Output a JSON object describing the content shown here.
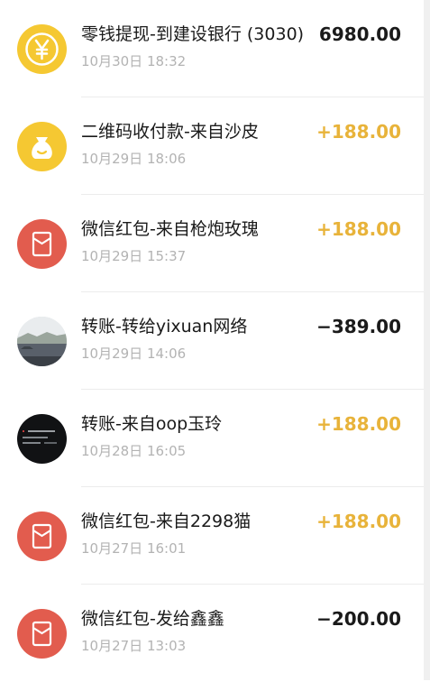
{
  "transactions": [
    {
      "title": "零钱提现-到建设银行 (3030)",
      "time": "10月30日 18:32",
      "amount": "6980.00",
      "kind": "expense",
      "icon": "yuan-coin-icon"
    },
    {
      "title": "二维码收付款-来自沙皮",
      "time": "10月29日 18:06",
      "amount": "+188.00",
      "kind": "income",
      "icon": "money-bag-icon"
    },
    {
      "title": "微信红包-来自枪炮玫瑰",
      "time": "10月29日 15:37",
      "amount": "+188.00",
      "kind": "income",
      "icon": "red-envelope-icon"
    },
    {
      "title": "转账-转给yixuan网络",
      "time": "10月29日 14:06",
      "amount": "−389.00",
      "kind": "expense",
      "icon": "avatar-photo-road"
    },
    {
      "title": "转账-来自oop玉玲",
      "time": "10月28日 16:05",
      "amount": "+188.00",
      "kind": "income",
      "icon": "avatar-photo-dark"
    },
    {
      "title": "微信红包-来自2298猫",
      "time": "10月27日 16:01",
      "amount": "+188.00",
      "kind": "income",
      "icon": "red-envelope-icon"
    },
    {
      "title": "微信红包-发给鑫鑫",
      "time": "10月27日 13:03",
      "amount": "−200.00",
      "kind": "expense",
      "icon": "red-envelope-icon"
    }
  ],
  "colors": {
    "income": "#e8b33a",
    "expense": "#1a1a1a",
    "red_icon": "#e25c4e",
    "yellow_icon": "#f5c832"
  }
}
